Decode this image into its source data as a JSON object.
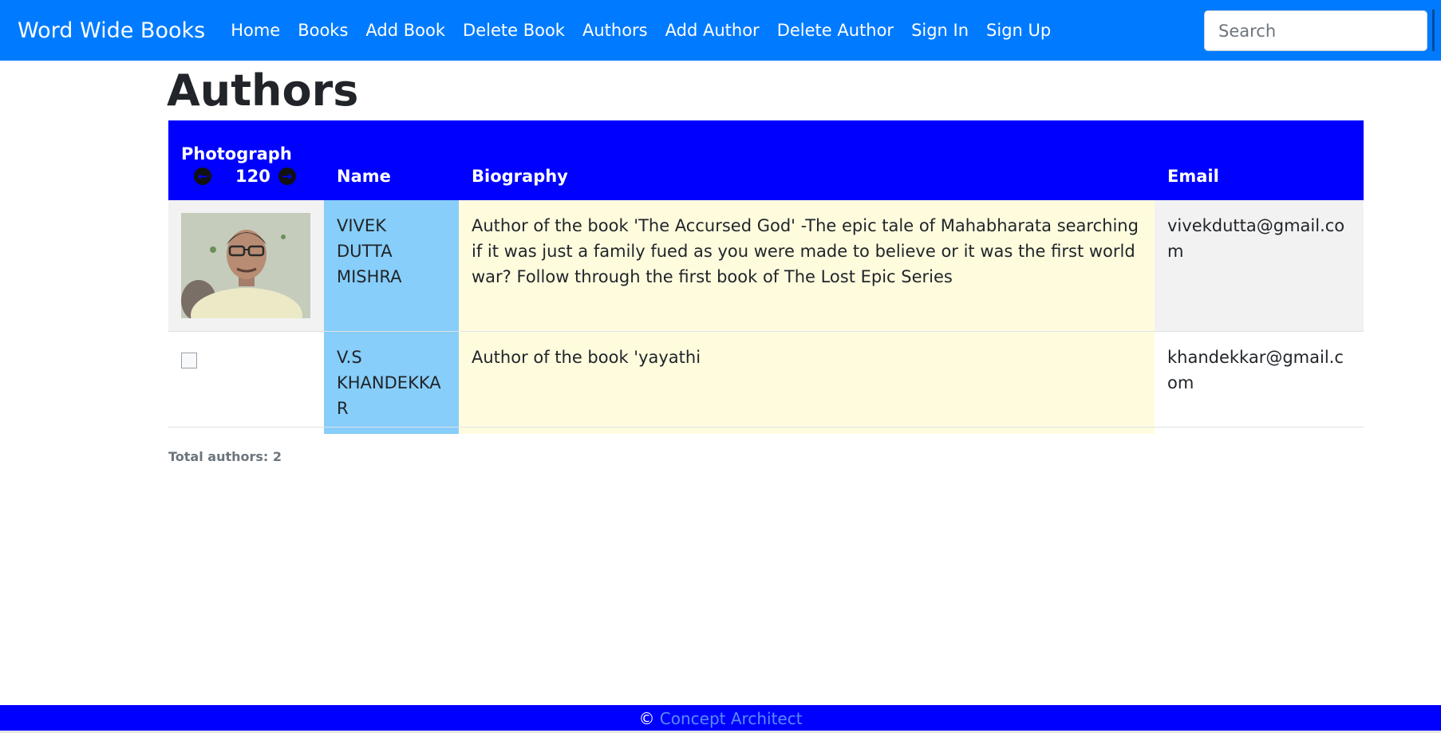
{
  "navbar": {
    "brand": "Word Wide Books",
    "links": [
      {
        "label": "Home"
      },
      {
        "label": "Books"
      },
      {
        "label": "Add Book"
      },
      {
        "label": "Delete Book"
      },
      {
        "label": "Authors"
      },
      {
        "label": "Add Author"
      },
      {
        "label": "Delete Author"
      },
      {
        "label": "Sign In"
      },
      {
        "label": "Sign Up"
      }
    ],
    "search_placeholder": "Search",
    "bg_color": "#007bff"
  },
  "page": {
    "title": "Authors"
  },
  "table": {
    "columns": {
      "photograph": "Photograph",
      "name": "Name",
      "biography": "Biography",
      "email": "Email"
    },
    "pager": {
      "prev_icon": "arrow-left-circle-icon",
      "value": "120",
      "next_icon": "arrow-right-circle-icon"
    },
    "header_color": "#0000ff",
    "rows": [
      {
        "photo": "author-photo",
        "name": "VIVEK DUTTA MISHRA",
        "biography": "Author of the book 'The Accursed God' -The epic tale of Mahabharata searching if it was just a family fued as you were made to believe or it was the first world war? Follow through the first book of The Lost Epic Series",
        "email": "vivekdutta@gmail.com"
      },
      {
        "photo": "broken-image",
        "name": "V.S KHANDEKKAR",
        "biography": "Author of the book 'yayathi",
        "email": "khandekkar@gmail.com"
      }
    ]
  },
  "summary": {
    "total": "Total authors: 2"
  },
  "footer": {
    "copyright": "©",
    "link": "Concept Architect",
    "bg_color": "#0000ff"
  }
}
